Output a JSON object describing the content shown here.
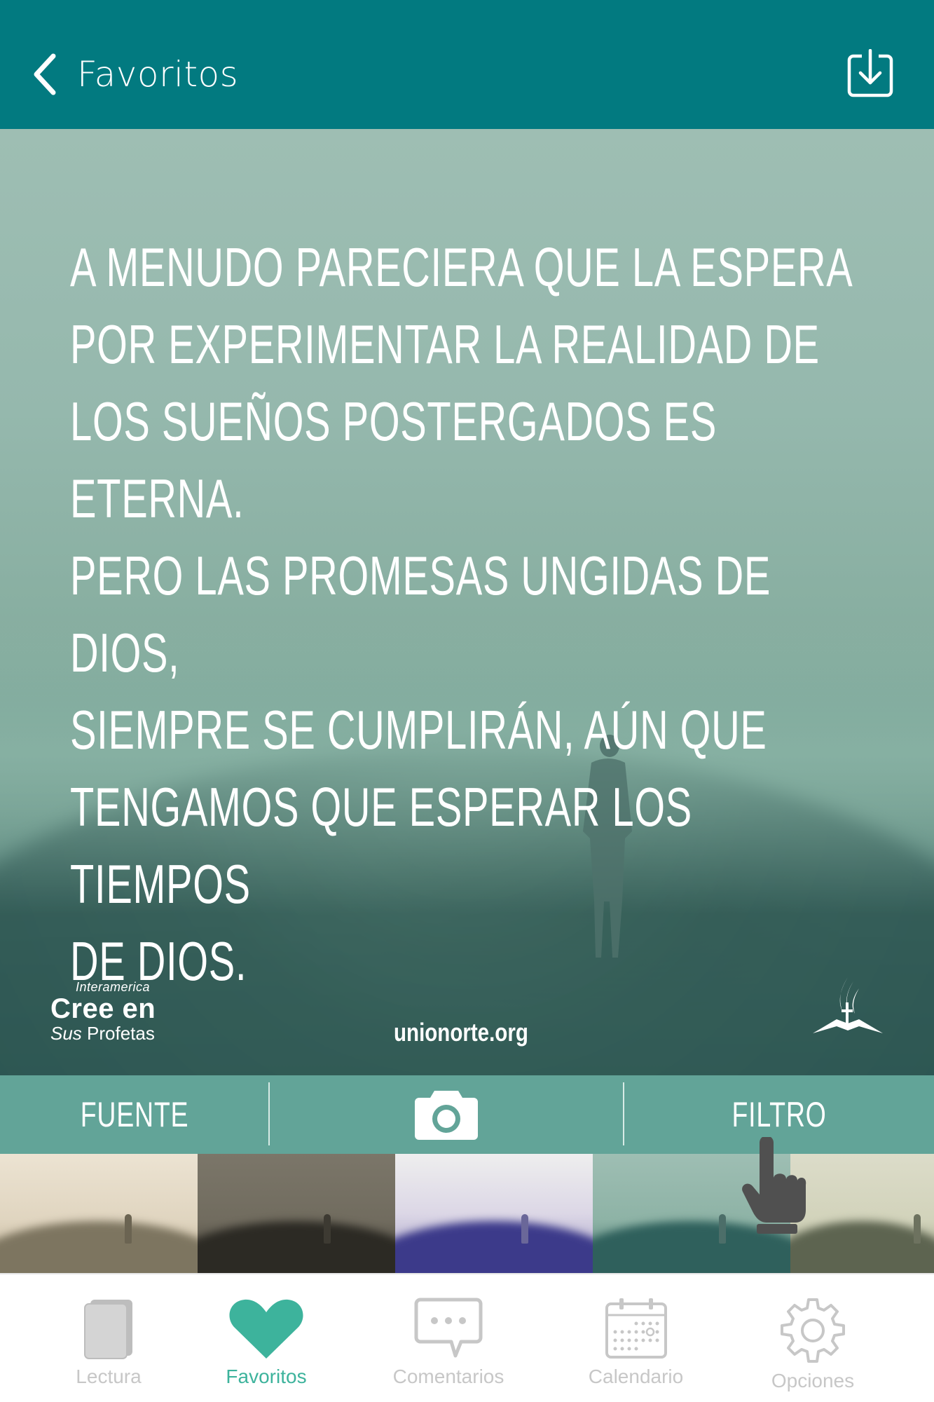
{
  "header": {
    "back_label": "Favoritos",
    "back_icon": "chevron-left-icon",
    "download_icon": "download-icon"
  },
  "quote_card": {
    "quote_lines": [
      "A menudo pareciera que la espera",
      "por experimentar la realidad de",
      "los sueños postergados es eterna.",
      "Pero las promesas ungidas de Dios,",
      "siempre se cumplirán, aún que",
      "tengamos que esperar los tiempos",
      "de Dios."
    ],
    "logo": {
      "line1": "Interamerica",
      "line2": "Cree en",
      "line3_italic": "Sus",
      "line3_rest": " Profetas"
    },
    "website": "unionorte.org"
  },
  "toolbar": {
    "font_label": "FUENTE",
    "camera_icon": "camera-icon",
    "filter_label": "FILTRO"
  },
  "filters": [
    {
      "name": "warm-sepia"
    },
    {
      "name": "dark-brown"
    },
    {
      "name": "violet"
    },
    {
      "name": "teal",
      "selected": true
    },
    {
      "name": "pale-olive"
    }
  ],
  "bottom_nav": [
    {
      "label": "Lectura",
      "icon": "book-icon",
      "active": false
    },
    {
      "label": "Favoritos",
      "icon": "heart-icon",
      "active": true
    },
    {
      "label": "Comentarios",
      "icon": "chat-bubble-icon",
      "active": false
    },
    {
      "label": "Calendario",
      "icon": "calendar-icon",
      "active": false
    },
    {
      "label": "Opciones",
      "icon": "gear-icon",
      "active": false
    }
  ],
  "colors": {
    "header_bg": "#027a80",
    "toolbar_bg": "#62a498",
    "accent": "#3db39c",
    "nav_inactive": "#c7c7c7"
  }
}
